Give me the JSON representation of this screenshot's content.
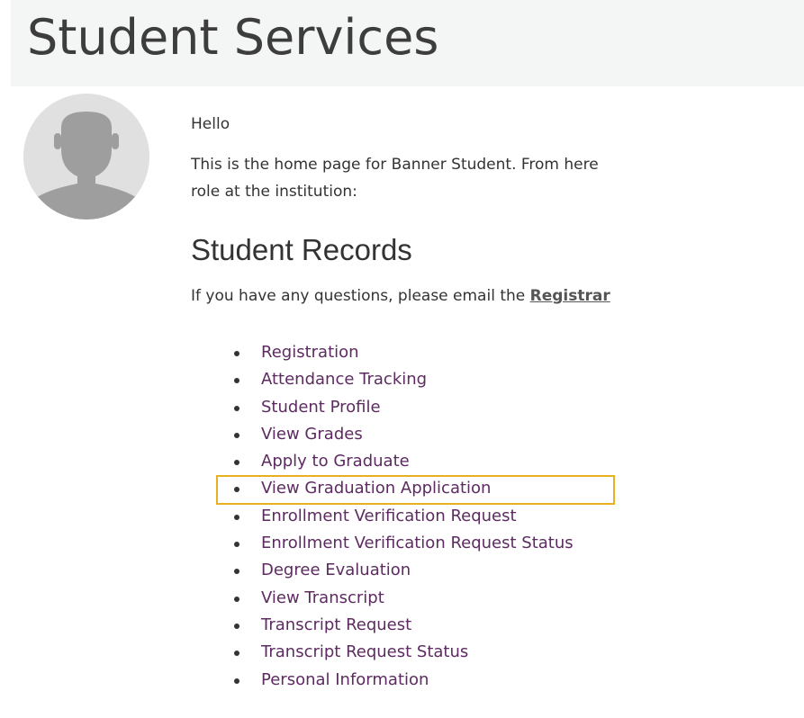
{
  "page": {
    "title": "Student Services"
  },
  "welcome": {
    "greeting": "Hello",
    "intro_line1": "This is the home page for Banner Student. From here",
    "intro_line2": "role at the institution:"
  },
  "student_records": {
    "heading": "Student Records",
    "contact_text": "If you have any questions, please email the ",
    "contact_link": "Registrar",
    "links": [
      "Registration",
      "Attendance Tracking",
      "Student Profile",
      "View Grades",
      "Apply to Graduate",
      "View Graduation Application",
      "Enrollment Verification Request",
      "Enrollment Verification Request Status",
      "Degree Evaluation",
      "View Transcript",
      "Transcript Request",
      "Transcript Request Status",
      "Personal Information"
    ],
    "highlighted_link": "View Graduation Application"
  },
  "icons": {
    "avatar": "user-avatar-icon"
  },
  "colors": {
    "link": "#5d2a61",
    "header_background": "#f4f5f5",
    "highlight_border": "#e8b020",
    "text": "#333333"
  }
}
